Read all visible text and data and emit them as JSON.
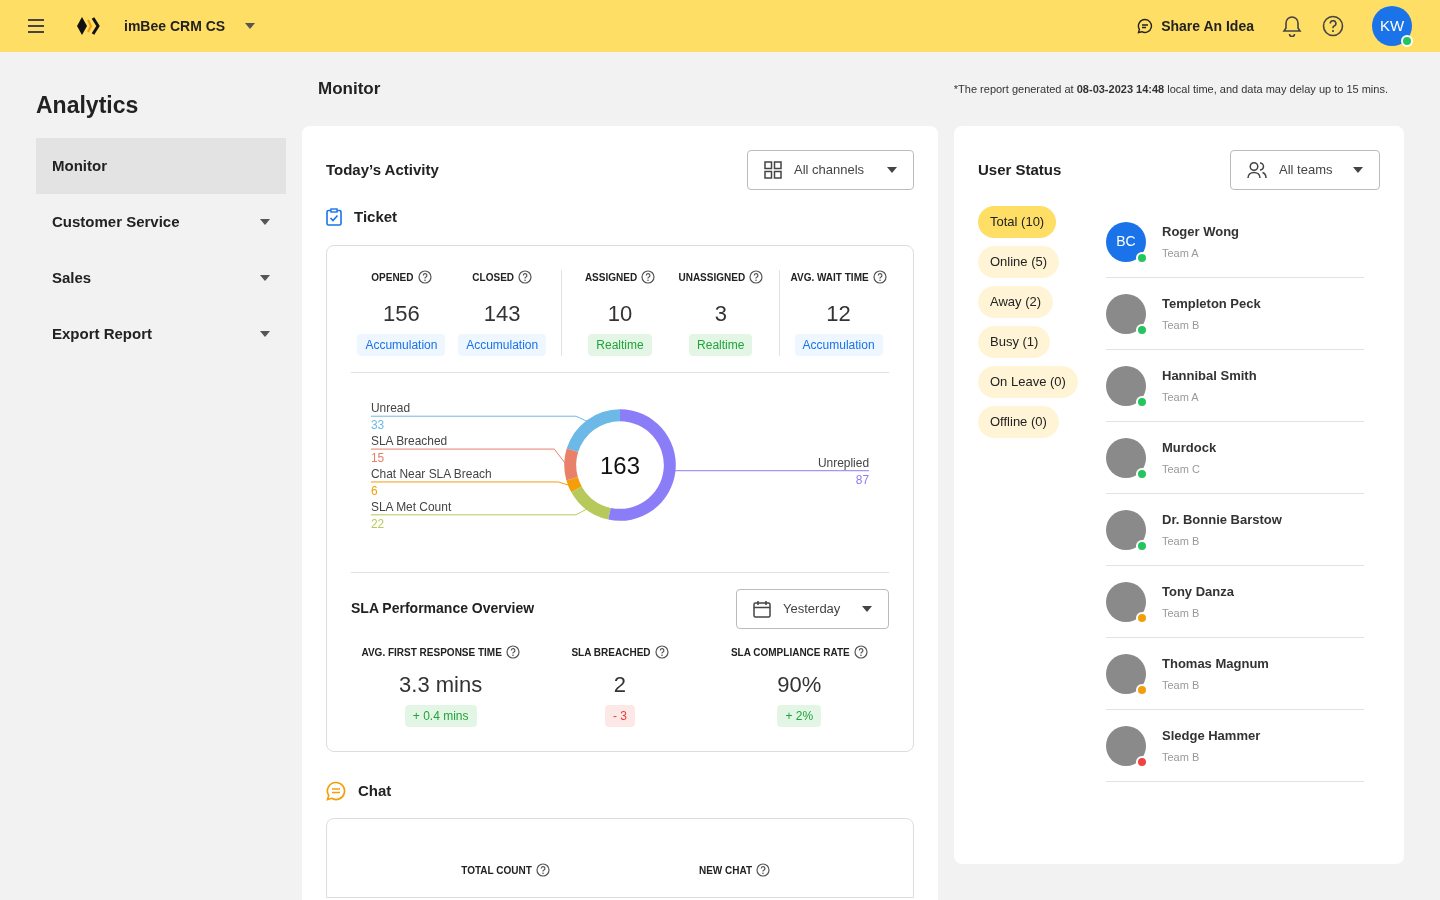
{
  "topbar": {
    "workspace": "imBee CRM CS",
    "share_idea": "Share An Idea",
    "user_initials": "KW",
    "user_online": true
  },
  "sidebar": {
    "title": "Analytics",
    "items": [
      {
        "label": "Monitor",
        "selected": true,
        "expandable": false
      },
      {
        "label": "Customer Service",
        "selected": false,
        "expandable": true
      },
      {
        "label": "Sales",
        "selected": false,
        "expandable": true
      },
      {
        "label": "Export Report",
        "selected": false,
        "expandable": true
      }
    ]
  },
  "page": {
    "title": "Monitor",
    "report_note": "*The report generated at **08-03-2023 14:48** local time, and data may delay up to 15 mins."
  },
  "activity": {
    "title": "Today’s Activity",
    "channel_filter": "All channels",
    "ticket": {
      "title": "Ticket",
      "stat_groups": [
        [
          {
            "label": "OPENED",
            "value": "156",
            "tag": "Accumulation",
            "kind": "accumulation"
          },
          {
            "label": "CLOSED",
            "value": "143",
            "tag": "Accumulation",
            "kind": "accumulation"
          }
        ],
        [
          {
            "label": "ASSIGNED",
            "value": "10",
            "tag": "Realtime",
            "kind": "realtime"
          },
          {
            "label": "UNASSIGNED",
            "value": "3",
            "tag": "Realtime",
            "kind": "realtime"
          }
        ],
        [
          {
            "label": "AVG. WAIT TIME",
            "value": "12",
            "tag": "Accumulation",
            "kind": "accumulation"
          }
        ]
      ],
      "center_total": "163",
      "chart_data": {
        "type": "donut",
        "categories": [
          "Unread",
          "SLA Breached",
          "Chat Near SLA Breach",
          "SLA Met Count",
          "Unreplied"
        ],
        "colors": [
          "#6cb8e6",
          "#e8806a",
          "#f59e0b",
          "#b8c95c",
          "#8b7cf8"
        ],
        "series": [
          {
            "values": [
              33,
              15,
              6,
              22,
              87
            ]
          }
        ],
        "data_labels": true
      },
      "sla": {
        "title": "SLA Performance Overview",
        "period": "Yesterday",
        "metrics": [
          {
            "label": "AVG. FIRST RESPONSE TIME",
            "value": "3.3 mins",
            "change": "+ 0.4 mins",
            "positive": true
          },
          {
            "label": "SLA BREACHED",
            "value": "2",
            "change": "- 3",
            "positive": false
          },
          {
            "label": "SLA COMPLIANCE RATE",
            "value": "90%",
            "change": "+ 2%",
            "positive": true
          }
        ]
      }
    },
    "chat": {
      "title": "Chat",
      "stats": [
        "TOTAL COUNT",
        "NEW CHAT"
      ]
    }
  },
  "user_status": {
    "title": "User Status",
    "team_filter": "All teams",
    "filters": [
      {
        "label": "Total (10)",
        "selected": true
      },
      {
        "label": "Online (5)",
        "selected": false
      },
      {
        "label": "Away (2)",
        "selected": false
      },
      {
        "label": "Busy (1)",
        "selected": false
      },
      {
        "label": "On Leave (0)",
        "selected": false
      },
      {
        "label": "Offline (0)",
        "selected": false
      }
    ],
    "users": [
      {
        "name": "Roger Wong",
        "team": "Team A",
        "kind": "initials",
        "initials": "BC",
        "color": "#22c55e"
      },
      {
        "name": "Templeton Peck",
        "team": "Team B",
        "kind": "photo",
        "color": "#22c55e"
      },
      {
        "name": "Hannibal Smith",
        "team": "Team A",
        "kind": "photo",
        "color": "#22c55e"
      },
      {
        "name": "Murdock",
        "team": "Team C",
        "kind": "photo",
        "color": "#22c55e"
      },
      {
        "name": "Dr. Bonnie Barstow",
        "team": "Team B",
        "kind": "photo",
        "color": "#22c55e"
      },
      {
        "name": "Tony Danza",
        "team": "Team B",
        "kind": "photo",
        "color": "#f59e0b"
      },
      {
        "name": "Thomas Magnum",
        "team": "Team B",
        "kind": "photo",
        "color": "#f59e0b"
      },
      {
        "name": "Sledge Hammer",
        "team": "Team B",
        "kind": "photo",
        "color": "#ef4444"
      }
    ]
  }
}
